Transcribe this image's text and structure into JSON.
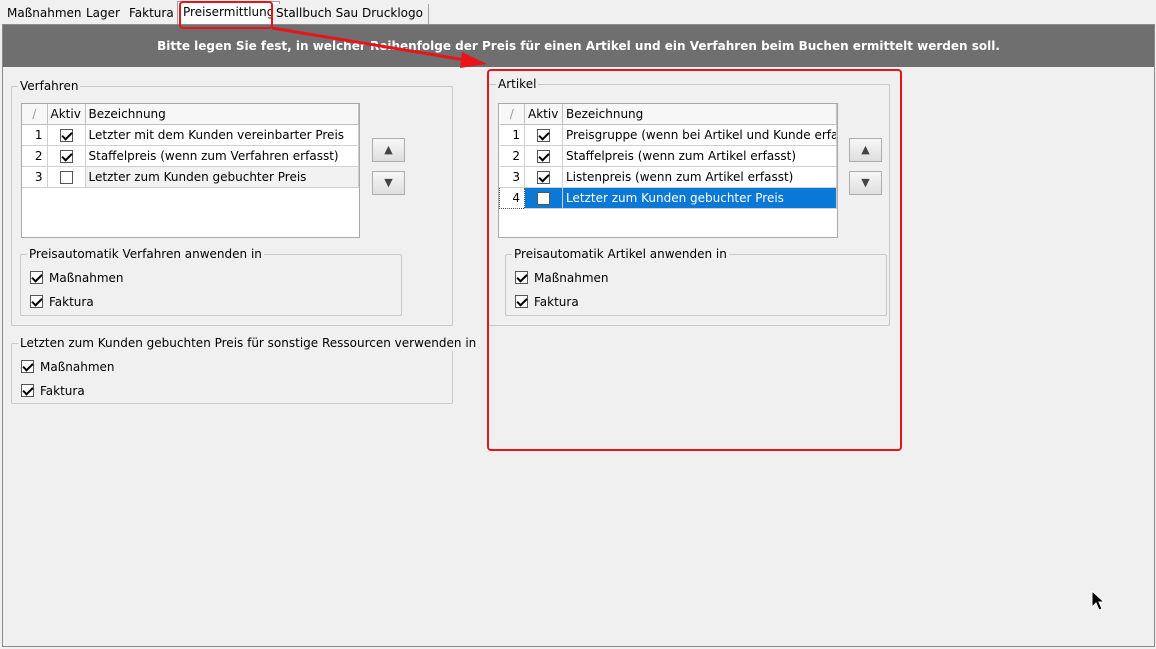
{
  "tabs": [
    {
      "label": "Maßnahmen",
      "active": false
    },
    {
      "label": "Lager",
      "active": false
    },
    {
      "label": "Faktura",
      "active": false
    },
    {
      "label": "Preisermittlung",
      "active": true
    },
    {
      "label": "Stallbuch Sau",
      "active": false
    },
    {
      "label": "Drucklogo",
      "active": false
    }
  ],
  "banner": "Bitte legen Sie fest, in welcher Reihenfolge der Preis für einen Artikel und ein Verfahren beim Buchen ermittelt werden soll.",
  "verfahren": {
    "title": "Verfahren",
    "columns": {
      "sort": "/",
      "aktiv": "Aktiv",
      "bezeichnung": "Bezeichnung"
    },
    "rows": [
      {
        "num": "1",
        "aktiv": true,
        "label": "Letzter mit dem Kunden vereinbarter Preis"
      },
      {
        "num": "2",
        "aktiv": true,
        "label": "Staffelpreis (wenn zum Verfahren erfasst)"
      },
      {
        "num": "3",
        "aktiv": false,
        "label": "Letzter zum Kunden gebuchter Preis"
      }
    ],
    "auto_group": {
      "title": "Preisautomatik Verfahren anwenden in",
      "massnahmen": {
        "label": "Maßnahmen",
        "checked": true
      },
      "faktura": {
        "label": "Faktura",
        "checked": true
      }
    }
  },
  "sonstige": {
    "title": "Letzten zum Kunden gebuchten Preis für sonstige Ressourcen verwenden in",
    "massnahmen": {
      "label": "Maßnahmen",
      "checked": true
    },
    "faktura": {
      "label": "Faktura",
      "checked": true
    }
  },
  "artikel": {
    "title": "Artikel",
    "columns": {
      "sort": "/",
      "aktiv": "Aktiv",
      "bezeichnung": "Bezeichnung"
    },
    "rows": [
      {
        "num": "1",
        "aktiv": true,
        "label": "Preisgruppe (wenn bei Artikel und Kunde erfasst)"
      },
      {
        "num": "2",
        "aktiv": true,
        "label": "Staffelpreis (wenn zum Artikel erfasst)"
      },
      {
        "num": "3",
        "aktiv": true,
        "label": "Listenpreis (wenn zum Artikel erfasst)"
      },
      {
        "num": "4",
        "aktiv": false,
        "label": "Letzter zum Kunden gebuchter Preis",
        "selected": true
      }
    ],
    "auto_group": {
      "title": "Preisautomatik Artikel anwenden in",
      "massnahmen": {
        "label": "Maßnahmen",
        "checked": true
      },
      "faktura": {
        "label": "Faktura",
        "checked": true
      }
    }
  },
  "buttons": {
    "up_icon": "▲",
    "down_icon": "▼"
  },
  "colors": {
    "annotation_red": "#e8141a",
    "selection_blue": "#0a78d7",
    "banner_gray": "#6f6f6f"
  }
}
